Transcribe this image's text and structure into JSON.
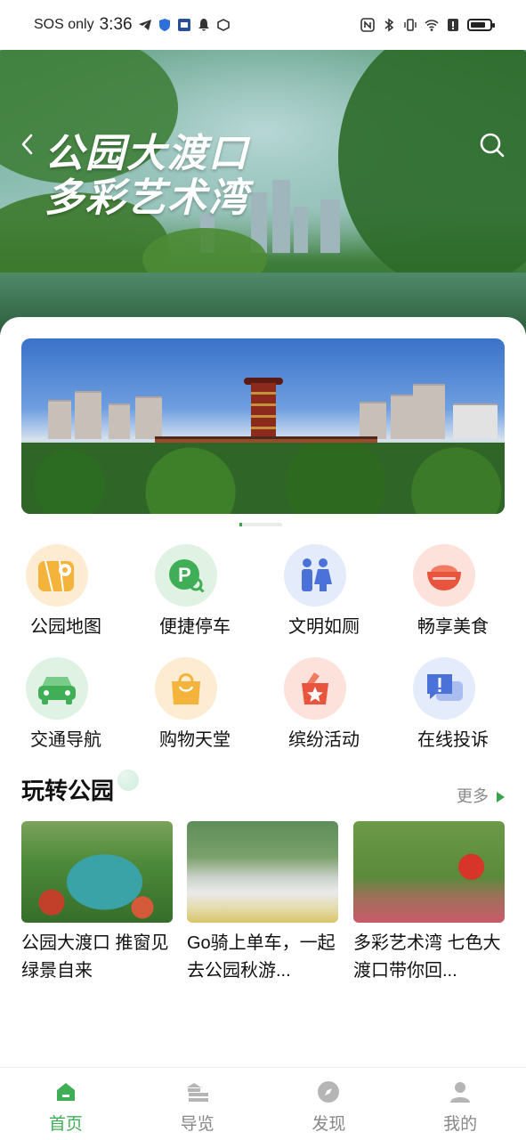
{
  "status_bar": {
    "carrier": "SOS only",
    "time": "3:36"
  },
  "hero": {
    "title_line1": "公园大渡口",
    "title_line2": "多彩艺术湾",
    "back_icon": "chevron-left-icon",
    "search_icon": "search-icon"
  },
  "banner": {
    "pages": 3,
    "active_page": 1
  },
  "grid": {
    "items": [
      {
        "label": "公园地图",
        "icon": "map-icon",
        "color": "#f4b33b"
      },
      {
        "label": "便捷停车",
        "icon": "parking-icon",
        "color": "#3fae56"
      },
      {
        "label": "文明如厕",
        "icon": "restroom-icon",
        "color": "#4a72d9"
      },
      {
        "label": "畅享美食",
        "icon": "food-bowl-icon",
        "color": "#e8543e"
      },
      {
        "label": "交通导航",
        "icon": "car-icon",
        "color": "#3fae56"
      },
      {
        "label": "购物天堂",
        "icon": "shopping-bag-icon",
        "color": "#f4b33b"
      },
      {
        "label": "缤纷活动",
        "icon": "activity-star-icon",
        "color": "#e8543e"
      },
      {
        "label": "在线投诉",
        "icon": "complaint-chat-icon",
        "color": "#4a72d9"
      }
    ]
  },
  "section": {
    "title": "玩转公园",
    "more": "更多"
  },
  "articles": [
    {
      "title": "公园大渡口 推窗见绿景自来"
    },
    {
      "title": "Go骑上单车，一起去公园秋游..."
    },
    {
      "title": "多彩艺术湾 七色大渡口带你回..."
    }
  ],
  "nav": {
    "items": [
      {
        "label": "首页",
        "icon": "home-icon"
      },
      {
        "label": "导览",
        "icon": "guide-icon"
      },
      {
        "label": "发现",
        "icon": "compass-icon"
      },
      {
        "label": "我的",
        "icon": "profile-icon"
      }
    ],
    "active": 0
  },
  "colors": {
    "accent": "#3fae56"
  }
}
